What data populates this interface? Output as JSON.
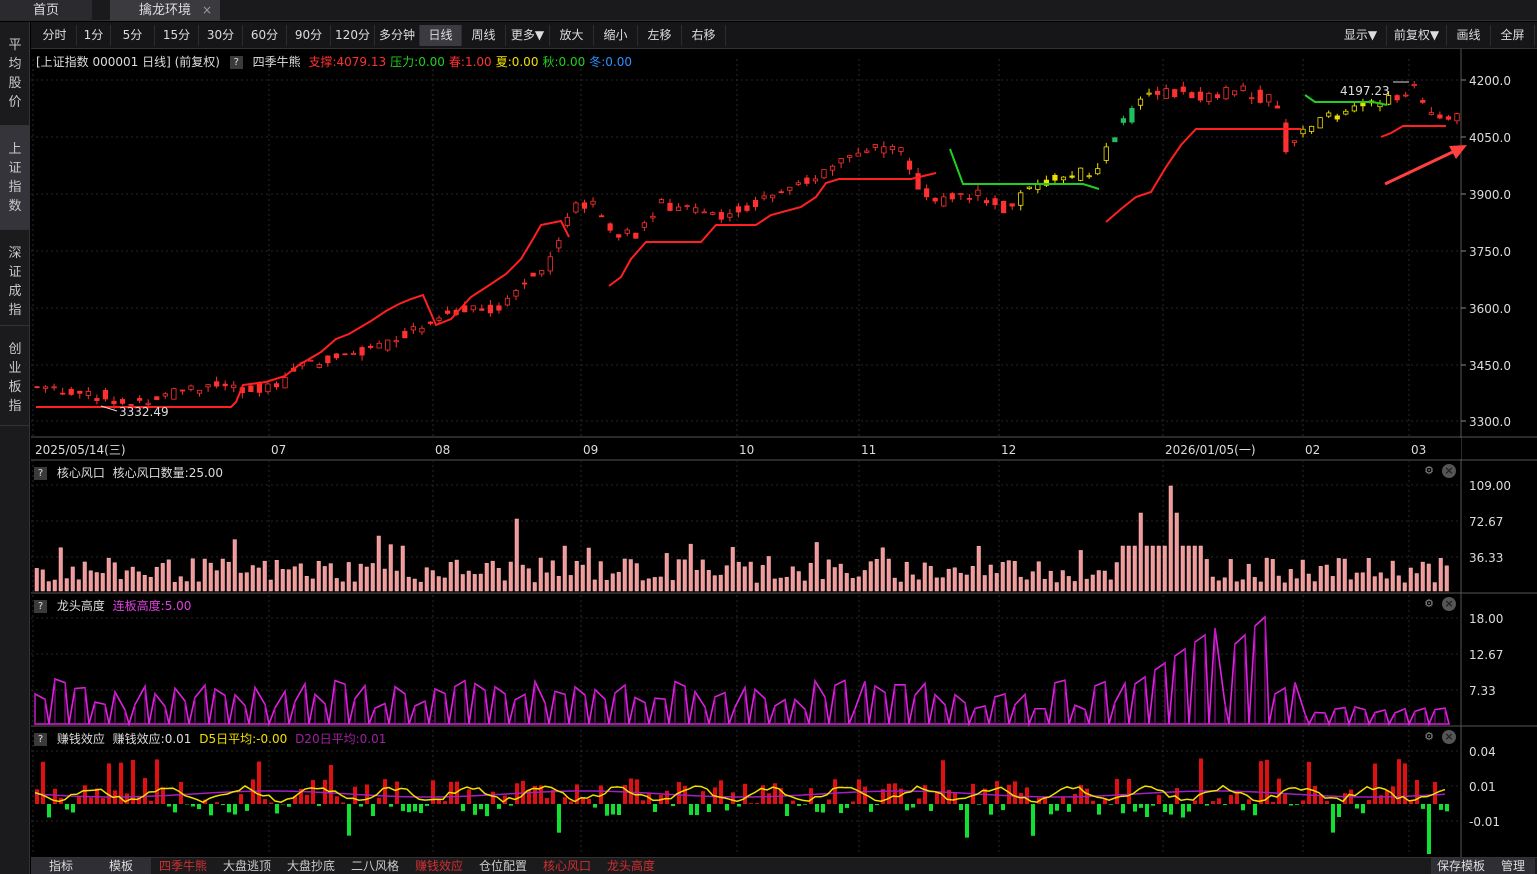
{
  "tabs": [
    {
      "label": "首页"
    },
    {
      "label": "擒龙环境",
      "close": "×"
    }
  ],
  "sidebar": [
    {
      "label": "平均股价",
      "chars": [
        "平",
        "均",
        "股",
        "价"
      ]
    },
    {
      "label": "上证指数",
      "chars": [
        "上",
        "证",
        "指",
        "数"
      ],
      "active": true
    },
    {
      "label": "深证成指",
      "chars": [
        "深",
        "证",
        "成",
        "指"
      ]
    },
    {
      "label": "创业板指",
      "chars": [
        "创",
        "业",
        "板",
        "指"
      ]
    }
  ],
  "toolbar": {
    "left": [
      "分时",
      "1分",
      "5分",
      "15分",
      "30分",
      "60分",
      "90分",
      "120分",
      "多分钟",
      "日线",
      "周线",
      "更多▼",
      "放大",
      "缩小",
      "左移",
      "右移"
    ],
    "active": "日线",
    "right": [
      "显示▼",
      "前复权▼",
      "画线",
      "全屏"
    ]
  },
  "main_panel": {
    "header": "[上证指数 000001 日线]  (前复权)",
    "indicator": "四季牛熊",
    "values": [
      {
        "text": "支撑:4079.13",
        "color": "#ff3030"
      },
      {
        "text": "压力:0.00",
        "color": "#20d020"
      },
      {
        "text": "春:1.00",
        "color": "#ff3030"
      },
      {
        "text": "夏:0.00",
        "color": "#f0e000"
      },
      {
        "text": "秋:0.00",
        "color": "#20d020"
      },
      {
        "text": "冬:0.00",
        "color": "#3090ff"
      }
    ],
    "price_labels": [
      "4200.0",
      "4050.0",
      "3900.0",
      "3750.0",
      "3600.0",
      "3450.0",
      "3300.0"
    ],
    "high_label": "4197.23",
    "low_label": "3332.49",
    "date_labels": [
      "2025/05/14(三)",
      "07",
      "08",
      "09",
      "10",
      "11",
      "12",
      "2026/01/05(一)",
      "02",
      "03"
    ]
  },
  "panel_core": {
    "name": "核心风口",
    "value_text": "核心风口数量:25.00",
    "labels": [
      "109.00",
      "72.67",
      "36.33"
    ]
  },
  "panel_dragon": {
    "name": "龙头高度",
    "value_text": "连板高度:5.00",
    "labels": [
      "18.00",
      "12.67",
      "7.33"
    ]
  },
  "panel_money": {
    "name": "赚钱效应",
    "value_text": "赚钱效应:0.01",
    "d5": "D5日平均:-0.00",
    "d20": "D20日平均:0.01",
    "labels": [
      "0.04",
      "0.01",
      "-0.01"
    ]
  },
  "bottombar": {
    "left": [
      {
        "label": "指标",
        "color": "#dddddd"
      },
      {
        "label": "模板",
        "color": "#dddddd"
      },
      {
        "label": "四季牛熊",
        "color": "#d03030"
      },
      {
        "label": "大盘逃顶",
        "color": "#cccccc"
      },
      {
        "label": "大盘抄底",
        "color": "#cccccc"
      },
      {
        "label": "二八风格",
        "color": "#cccccc"
      },
      {
        "label": "赚钱效应",
        "color": "#d03030"
      },
      {
        "label": "仓位配置",
        "color": "#cccccc"
      },
      {
        "label": "核心风口",
        "color": "#d03030"
      },
      {
        "label": "龙头高度",
        "color": "#d03030"
      }
    ],
    "right": [
      "保存模板",
      "管理"
    ]
  }
}
